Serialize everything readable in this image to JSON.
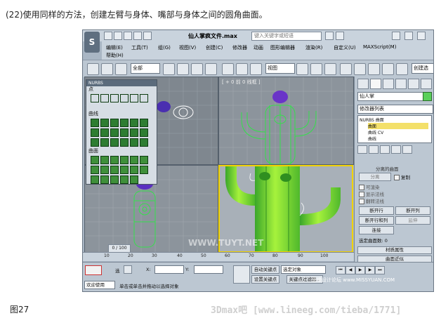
{
  "caption": "(22)使用同样的方法，创建左臂与身体、嘴部与身体之间的圆角曲面。",
  "figure_label": "图27",
  "credit": "3Dmax吧 [www.lineeg.com/tieba/1771]",
  "window": {
    "title": "仙人掌疯文件.max",
    "search_placeholder": "键入关键字或短语"
  },
  "menu": [
    "编辑(E)",
    "工具(T)",
    "组(G)",
    "视图(V)",
    "创建(C)",
    "修改器",
    "动画",
    "图形编辑器",
    "渲染(R)",
    "自定义(U)",
    "MAXScript(M)",
    "帮助(H)"
  ],
  "toolbar": {
    "selection_filter": "全部",
    "view_select": "视图",
    "create_selection": "创建选"
  },
  "nurbs_panel": {
    "title": "NURBS",
    "sections": [
      "点",
      "曲线",
      "曲面"
    ]
  },
  "viewports": {
    "top_left_label": "",
    "top_right_label": "[ + 0 前 0 线框 ]",
    "bottom_left_label": "",
    "bottom_right_label": ""
  },
  "command_panel": {
    "object_name": "仙人掌",
    "modifier_list": "修改器列表",
    "stack": [
      {
        "label": "NURBS 曲面",
        "highlight": false
      },
      {
        "label": "曲面",
        "highlight": true
      },
      {
        "label": "曲线 CV",
        "highlight": false
      },
      {
        "label": "曲线",
        "highlight": false
      }
    ],
    "separate_header": "分离的曲面",
    "separate_button": "分离",
    "copy_label": "复制",
    "checks": [
      "可渲染",
      "显示法线",
      "翻转法线"
    ],
    "buttons": [
      "断开行",
      "断开列",
      "断开行和列",
      "延伸",
      "连接"
    ],
    "selected_count": "选定曲面数: 0",
    "rollouts": [
      "材质属性",
      "曲面近似"
    ]
  },
  "timeline": {
    "frame_display": "0 / 100",
    "ticks": [
      "10",
      "20",
      "30",
      "40",
      "50",
      "60",
      "70",
      "80",
      "90",
      "100"
    ]
  },
  "status": {
    "selected": "选",
    "x_label": "X:",
    "y_label": "Y:",
    "auto_key": "自动关键点",
    "set_key": "设置关键点",
    "key_mode": "选定对象",
    "key_filter": "关键点过滤器...",
    "welcome": "欢迎使用",
    "prompt": "单击或单击并拖动以选择对象"
  },
  "watermarks": {
    "center": "WWW.TUYT.NET",
    "corner": "思缘设计论坛 www.MISSYUAN.COM"
  }
}
